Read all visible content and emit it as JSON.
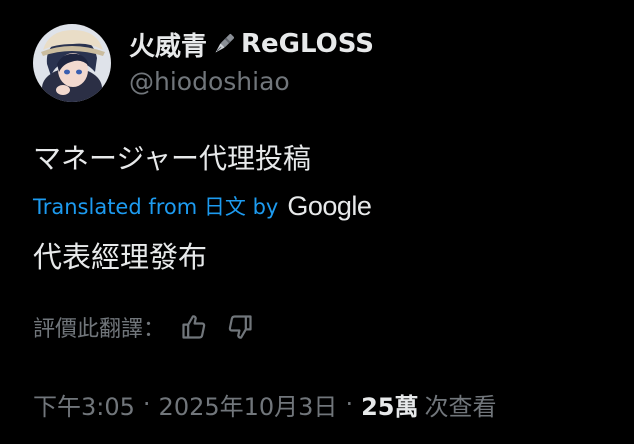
{
  "author": {
    "name_prefix": "火威青",
    "name_suffix": "ReGLOSS",
    "name_emoji": "fountain-pen-emoji",
    "handle": "@hiodoshiao"
  },
  "post": {
    "original_text": "マネージャー代理投稿",
    "translation_label": "Translated from 日文 by",
    "translation_provider": "Google",
    "translated_text": "代表經理發布"
  },
  "rating": {
    "label": "評價此翻譯：",
    "thumbs_up_icon": "thumbs-up-icon",
    "thumbs_down_icon": "thumbs-down-icon"
  },
  "meta": {
    "time": "下午3:05",
    "separator": "·",
    "date": "2025年10月3日",
    "views_count": "25萬",
    "views_label": "次查看"
  },
  "colors": {
    "background": "#000000",
    "primary_text": "#e7e9ea",
    "secondary_text": "#71767b",
    "link": "#1d9bf0"
  }
}
